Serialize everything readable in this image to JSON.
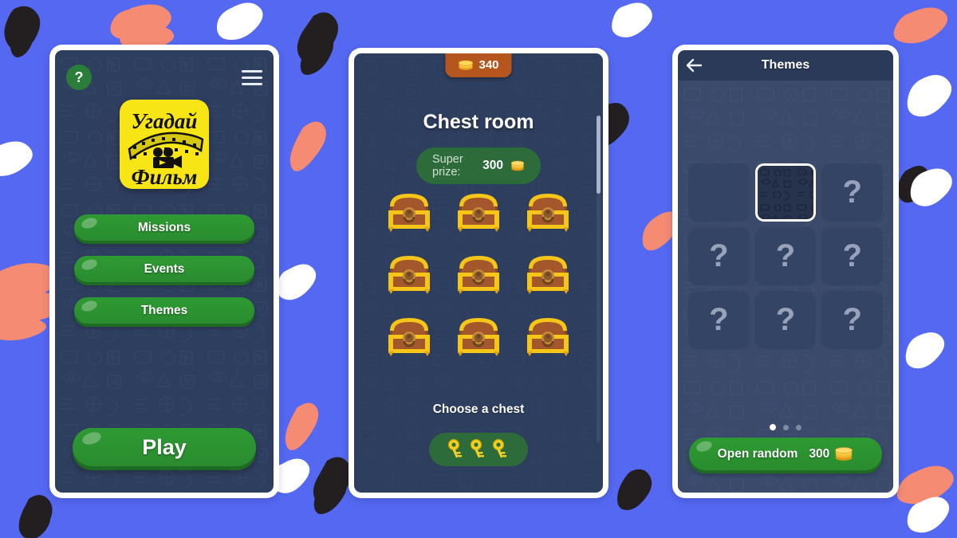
{
  "background": {
    "color": "#5468F2",
    "stroke_colors": {
      "black": "#231f20",
      "coral": "#f58b72",
      "white": "#ffffff"
    }
  },
  "theme_colors": {
    "screen_navy": "#2e3e5e",
    "themes_body": "#3b4a6b",
    "green": "#2e9a33",
    "green_dark": "#1e6b23",
    "prize_green": "#2d6b3a",
    "coin_orange": "#b5561e",
    "logo_yellow": "#f7e515",
    "header_navy": "#2b3a58"
  },
  "phone_home": {
    "help_button": {
      "label": "?",
      "icon": "question-mark-icon"
    },
    "menu_button": {
      "icon": "hamburger-menu-icon"
    },
    "logo": {
      "top_text": "Угадай",
      "bottom_text": "Фильм",
      "icon": "film-strip-movie-camera-icon"
    },
    "menu_items": [
      {
        "label": "Missions"
      },
      {
        "label": "Events"
      },
      {
        "label": "Themes"
      }
    ],
    "play_label": "Play"
  },
  "phone_chest": {
    "coin_badge": {
      "amount": "340",
      "icon": "coins-icon"
    },
    "title": "Chest room",
    "super_prize": {
      "label": "Super prize:",
      "amount": "300",
      "icon": "coin-stack-icon"
    },
    "chests": [
      {
        "id": "chest-1",
        "icon": "treasure-chest-icon",
        "state": "closed"
      },
      {
        "id": "chest-2",
        "icon": "treasure-chest-icon",
        "state": "closed"
      },
      {
        "id": "chest-3",
        "icon": "treasure-chest-icon",
        "state": "closed"
      },
      {
        "id": "chest-4",
        "icon": "treasure-chest-icon",
        "state": "closed"
      },
      {
        "id": "chest-5",
        "icon": "treasure-chest-icon",
        "state": "closed"
      },
      {
        "id": "chest-6",
        "icon": "treasure-chest-icon",
        "state": "closed"
      },
      {
        "id": "chest-7",
        "icon": "treasure-chest-icon",
        "state": "closed"
      },
      {
        "id": "chest-8",
        "icon": "treasure-chest-icon",
        "state": "closed"
      },
      {
        "id": "chest-9",
        "icon": "treasure-chest-icon",
        "state": "closed"
      }
    ],
    "choose_label": "Choose a chest",
    "keys": {
      "count": 3,
      "icon": "key-icon"
    },
    "scrollbar": {
      "visible": true
    }
  },
  "phone_themes": {
    "back_button": {
      "icon": "arrow-left-icon"
    },
    "title": "Themes",
    "tiles": [
      {
        "id": "theme-1",
        "label": "",
        "state": "owned-blank"
      },
      {
        "id": "theme-2",
        "label": "",
        "state": "selected"
      },
      {
        "id": "theme-3",
        "label": "?",
        "state": "locked"
      },
      {
        "id": "theme-4",
        "label": "?",
        "state": "locked"
      },
      {
        "id": "theme-5",
        "label": "?",
        "state": "locked"
      },
      {
        "id": "theme-6",
        "label": "?",
        "state": "locked"
      },
      {
        "id": "theme-7",
        "label": "?",
        "state": "locked"
      },
      {
        "id": "theme-8",
        "label": "?",
        "state": "locked"
      },
      {
        "id": "theme-9",
        "label": "?",
        "state": "locked"
      }
    ],
    "pager": {
      "total": 3,
      "active_index": 0
    },
    "open_random": {
      "label": "Open random",
      "price": "300",
      "icon": "coin-stack-icon"
    }
  }
}
